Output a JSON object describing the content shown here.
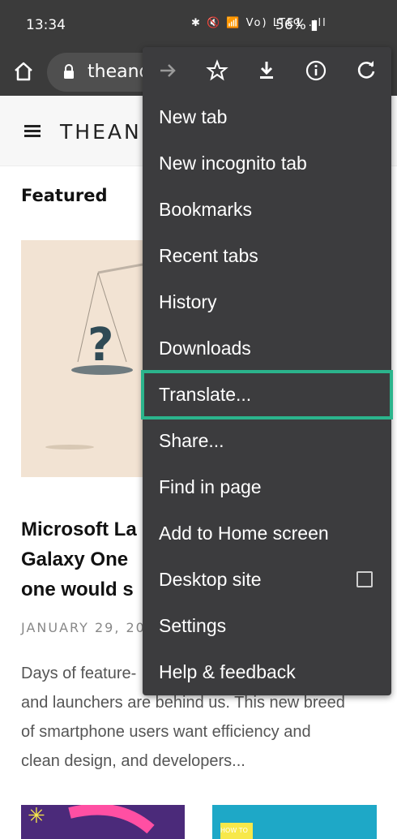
{
  "status_bar": {
    "time": "13:34",
    "icons_text": "✱ 🔇 📶 Vo) LTE1 .ıll",
    "battery": "56%"
  },
  "toolbar": {
    "url": "theandroidsoul.com"
  },
  "site": {
    "logo_text": "THEAND",
    "featured_label": "Featured",
    "article": {
      "title": "Microsoft Launcher on Samsung Galaxy One UI: Why one would switch",
      "title_visible": [
        "Microsoft La",
        "Galaxy One",
        "one would s"
      ],
      "date": "JANUARY 29, 20",
      "excerpt_lines": [
        "Days of feature-",
        "and launchers are behind us. This new breed",
        "of smartphone users want efficiency and",
        "clean design, and developers..."
      ]
    }
  },
  "menu": {
    "icons": [
      "forward-arrow-icon",
      "star-icon",
      "download-icon",
      "info-icon",
      "refresh-icon"
    ],
    "items": [
      {
        "label": "New tab"
      },
      {
        "label": "New incognito tab"
      },
      {
        "label": "Bookmarks"
      },
      {
        "label": "Recent tabs"
      },
      {
        "label": "History"
      },
      {
        "label": "Downloads"
      },
      {
        "label": "Translate..."
      },
      {
        "label": "Share..."
      },
      {
        "label": "Find in page"
      },
      {
        "label": "Add to Home screen"
      },
      {
        "label": "Desktop site"
      },
      {
        "label": "Settings"
      },
      {
        "label": "Help & feedback"
      }
    ],
    "highlight_color": "#2bb48c"
  },
  "colors": {
    "menu_bg": "#3c3c3e",
    "toolbar_bg": "#3b3b3b",
    "text_on_dark": "#ffffff"
  }
}
